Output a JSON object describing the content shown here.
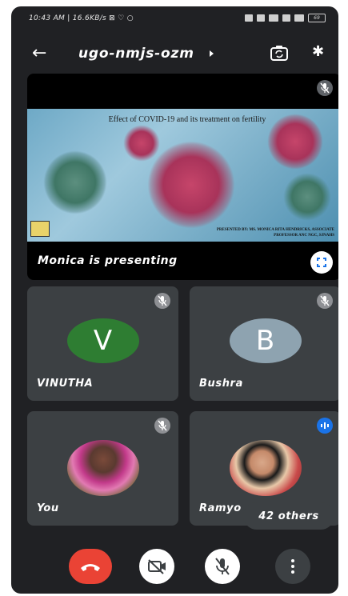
{
  "status_bar": {
    "left_text": "10:43 AM | 16.6KB/s ⊠ ♡ ○",
    "battery": "69"
  },
  "app_bar": {
    "meeting_code": "ugo-nmjs-ozm"
  },
  "presentation": {
    "slide_title": "Effect of COVID-19 and its treatment on fertility",
    "slide_credit": "PRESENTED BY: MS. MONICA RITA HENDRICKS, ASSOCIATE PROFESSOR ANC NGC, SJNAHS",
    "presenter_label": "Monica is presenting"
  },
  "participants": [
    {
      "name": "VINUTHA",
      "initial": "V",
      "color": "#2e7d32"
    },
    {
      "name": "Bushra",
      "initial": "B",
      "color": "#8ea3b0"
    },
    {
      "name": "You"
    },
    {
      "name": "Ramyo"
    }
  ],
  "others_label": "42 others",
  "colors": {
    "background": "#202124",
    "tile": "#3c4043",
    "end_call": "#ea4335",
    "speaking": "#1a73e8"
  }
}
